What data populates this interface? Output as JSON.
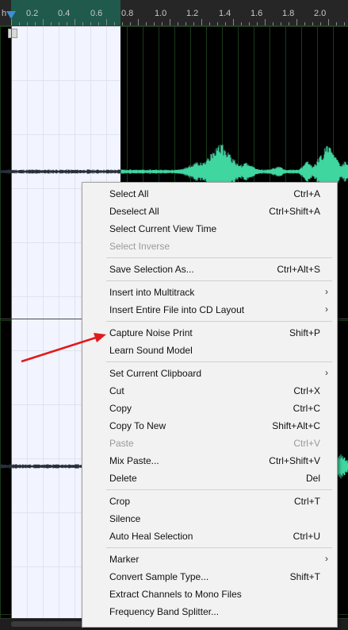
{
  "ruler": {
    "ticks": [
      "h",
      "0.2",
      "0.4",
      "0.6",
      "0.8",
      "1.0",
      "1.2",
      "1.4",
      "1.6",
      "1.8",
      "2.0"
    ]
  },
  "menu": {
    "items": [
      {
        "label": "Select All",
        "shortcut": "Ctrl+A",
        "disabled": false,
        "submenu": false
      },
      {
        "label": "Deselect All",
        "shortcut": "Ctrl+Shift+A",
        "disabled": false,
        "submenu": false
      },
      {
        "label": "Select Current View Time",
        "shortcut": "",
        "disabled": false,
        "submenu": false
      },
      {
        "label": "Select Inverse",
        "shortcut": "",
        "disabled": true,
        "submenu": false
      },
      {
        "label": "Save Selection As...",
        "shortcut": "Ctrl+Alt+S",
        "disabled": false,
        "submenu": false
      },
      {
        "label": "Insert into Multitrack",
        "shortcut": "",
        "disabled": false,
        "submenu": true
      },
      {
        "label": "Insert Entire File into CD Layout",
        "shortcut": "",
        "disabled": false,
        "submenu": true
      },
      {
        "label": "Capture Noise Print",
        "shortcut": "Shift+P",
        "disabled": false,
        "submenu": false
      },
      {
        "label": "Learn Sound Model",
        "shortcut": "",
        "disabled": false,
        "submenu": false
      },
      {
        "label": "Set Current Clipboard",
        "shortcut": "",
        "disabled": false,
        "submenu": true
      },
      {
        "label": "Cut",
        "shortcut": "Ctrl+X",
        "disabled": false,
        "submenu": false
      },
      {
        "label": "Copy",
        "shortcut": "Ctrl+C",
        "disabled": false,
        "submenu": false
      },
      {
        "label": "Copy To New",
        "shortcut": "Shift+Alt+C",
        "disabled": false,
        "submenu": false
      },
      {
        "label": "Paste",
        "shortcut": "Ctrl+V",
        "disabled": true,
        "submenu": false
      },
      {
        "label": "Mix Paste...",
        "shortcut": "Ctrl+Shift+V",
        "disabled": false,
        "submenu": false
      },
      {
        "label": "Delete",
        "shortcut": "Del",
        "disabled": false,
        "submenu": false
      },
      {
        "label": "Crop",
        "shortcut": "Ctrl+T",
        "disabled": false,
        "submenu": false
      },
      {
        "label": "Silence",
        "shortcut": "",
        "disabled": false,
        "submenu": false
      },
      {
        "label": "Auto Heal Selection",
        "shortcut": "Ctrl+U",
        "disabled": false,
        "submenu": false
      },
      {
        "label": "Marker",
        "shortcut": "",
        "disabled": false,
        "submenu": true
      },
      {
        "label": "Convert Sample Type...",
        "shortcut": "Shift+T",
        "disabled": false,
        "submenu": false
      },
      {
        "label": "Extract Channels to Mono Files",
        "shortcut": "",
        "disabled": false,
        "submenu": false
      },
      {
        "label": "Frequency Band Splitter...",
        "shortcut": "",
        "disabled": false,
        "submenu": false
      }
    ],
    "submenu_glyph": "›",
    "separators_after": [
      3,
      4,
      6,
      8,
      15,
      18
    ]
  },
  "colors": {
    "waveform": "#3fd6a0",
    "waveform_dark": "#27303a",
    "annotation_arrow": "#e01b1b",
    "selection_bg": "#f2f4ff",
    "cursor": "#d4243b"
  }
}
